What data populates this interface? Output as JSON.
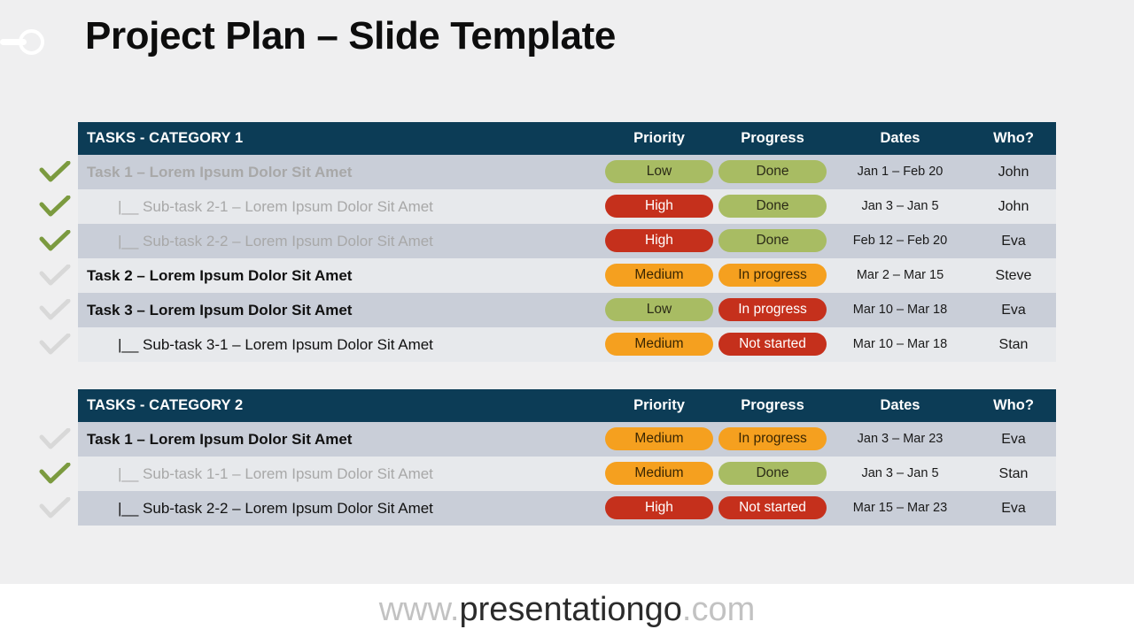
{
  "slide": {
    "title": "Project Plan – Slide Template",
    "background_color": "#efeff0",
    "logo_icon": "circle-line-logo-icon"
  },
  "palette": {
    "header_navy": "#0c3c56",
    "row_dark": "#c9ced8",
    "row_light": "#e7e9ec",
    "pill_green": "#a8bc63",
    "pill_orange": "#f5a01f",
    "pill_red": "#c5301c",
    "check_green": "#7b9a3f",
    "check_gray": "#d8d8d8",
    "text_active": "#111111",
    "text_faded": "#a8a8a8"
  },
  "columns": {
    "priority": "Priority",
    "progress": "Progress",
    "dates": "Dates",
    "who": "Who?"
  },
  "tables": [
    {
      "category": "TASKS - CATEGORY 1",
      "rows": [
        {
          "check": "green",
          "indent": 0,
          "state": "faded",
          "task": "Task 1 – Lorem Ipsum Dolor Sit Amet",
          "priority": "Low",
          "priority_color": "green",
          "progress": "Done",
          "progress_color": "green",
          "dates": "Jan 1 – Feb 20",
          "who": "John"
        },
        {
          "check": "green",
          "indent": 1,
          "state": "faded",
          "task": "|__ Sub-task 2-1 – Lorem Ipsum Dolor Sit Amet",
          "priority": "High",
          "priority_color": "red",
          "progress": "Done",
          "progress_color": "green",
          "dates": "Jan 3 – Jan 5",
          "who": "John"
        },
        {
          "check": "green",
          "indent": 1,
          "state": "faded",
          "task": "|__ Sub-task 2-2 – Lorem Ipsum Dolor Sit Amet",
          "priority": "High",
          "priority_color": "red",
          "progress": "Done",
          "progress_color": "green",
          "dates": "Feb 12 – Feb 20",
          "who": "Eva"
        },
        {
          "check": "gray",
          "indent": 0,
          "state": "active",
          "task": "Task 2 – Lorem Ipsum Dolor Sit Amet",
          "priority": "Medium",
          "priority_color": "orange",
          "progress": "In progress",
          "progress_color": "orange",
          "dates": "Mar 2 – Mar 15",
          "who": "Steve"
        },
        {
          "check": "gray",
          "indent": 0,
          "state": "active",
          "task": "Task 3 – Lorem Ipsum Dolor Sit Amet",
          "priority": "Low",
          "priority_color": "green",
          "progress": "In progress",
          "progress_color": "red",
          "dates": "Mar 10 – Mar 18",
          "who": "Eva"
        },
        {
          "check": "gray",
          "indent": 1,
          "state": "active",
          "task": "|__ Sub-task 3-1 – Lorem Ipsum Dolor Sit Amet",
          "priority": "Medium",
          "priority_color": "orange",
          "progress": "Not started",
          "progress_color": "red",
          "dates": "Mar 10 – Mar 18",
          "who": "Stan"
        }
      ]
    },
    {
      "category": "TASKS - CATEGORY 2",
      "rows": [
        {
          "check": "gray",
          "indent": 0,
          "state": "active",
          "task": "Task 1 – Lorem Ipsum Dolor Sit Amet",
          "priority": "Medium",
          "priority_color": "orange",
          "progress": "In progress",
          "progress_color": "orange",
          "dates": "Jan 3 – Mar 23",
          "who": "Eva"
        },
        {
          "check": "green",
          "indent": 1,
          "state": "faded",
          "task": "|__ Sub-task 1-1 – Lorem Ipsum Dolor Sit Amet",
          "priority": "Medium",
          "priority_color": "orange",
          "progress": "Done",
          "progress_color": "green",
          "dates": "Jan 3 – Jan 5",
          "who": "Stan"
        },
        {
          "check": "gray",
          "indent": 1,
          "state": "active",
          "task": "|__ Sub-task 2-2 – Lorem Ipsum Dolor Sit Amet",
          "priority": "High",
          "priority_color": "red",
          "progress": "Not started",
          "progress_color": "red",
          "dates": "Mar 15 – Mar 23",
          "who": "Eva"
        }
      ]
    }
  ],
  "watermark": {
    "prefix": "www.",
    "brand": "presentationgo",
    "suffix": ".com"
  }
}
